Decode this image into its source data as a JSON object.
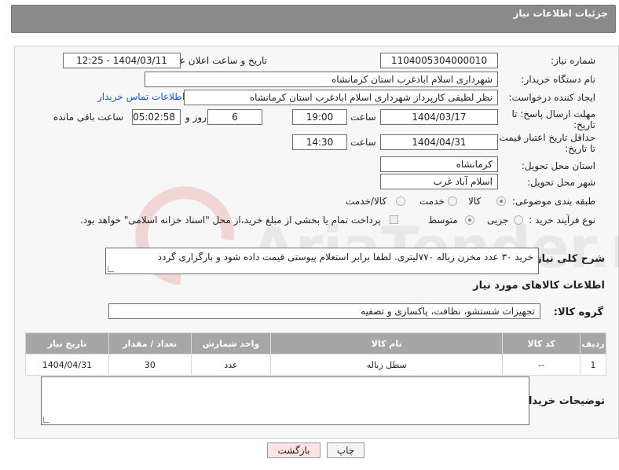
{
  "header": {
    "title": "جزئیات اطلاعات نیاز"
  },
  "form": {
    "need_number_label": "شماره نیاز:",
    "need_number": "1104005304000010",
    "announce_label": "تاریخ و ساعت اعلان عمومی:",
    "announce_value": "1404/03/11 - 12:25",
    "buyer_org_label": "نام دستگاه خریدار:",
    "buyer_org": "شهرداری اسلام ابادغرب استان کرمانشاه",
    "creator_label": "ایجاد کننده درخواست:",
    "creator": "نظر لطیفی کارپرداز شهرداری اسلام ابادغرب استان کرمانشاه",
    "contact_link": "اطلاعات تماس خریدار",
    "deadline_label_1": "مهلت ارسال پاسخ: تا",
    "deadline_label_2": "تاریخ:",
    "deadline_date": "1404/03/17",
    "time_label": "ساعت",
    "deadline_time": "19:00",
    "days_value": "6",
    "days_label": "روز و",
    "remaining_value": "05:02:58",
    "remaining_label": "ساعت باقی مانده",
    "validity_label_1": "حداقل تاریخ اعتبار قیمت:",
    "validity_label_2": "تا تاریخ:",
    "validity_date": "1404/04/31",
    "validity_time": "14:30",
    "province_label": "استان محل تحویل:",
    "province": "کرمانشاه",
    "city_label": "شهر محل تحویل:",
    "city": "اسلام آباد غرب",
    "category_label": "طبقه بندی موضوعی:",
    "category_options": [
      "کالا",
      "خدمت",
      "کالا/خدمت"
    ],
    "process_label": "نوع فرآیند خرید :",
    "process_options": [
      "جزیی",
      "متوسط"
    ],
    "payment_note": "پرداخت تمام یا بخشی از مبلغ خرید،از محل \"اسناد خزانه اسلامی\" خواهد بود.",
    "description_label": "شرح کلی نیاز:",
    "description": "خرید ۳۰ عدد مخزن زباله ۷۷۰لیتری. لطفا برابر استعلام پیوستی قیمت داده شود و بارگزاری گردد",
    "goods_info_title": "اطلاعات کالاهای مورد نیاز",
    "goods_group_label": "گروه کالا:",
    "goods_group": "تجهیزات شستشو، نظافت، پاکسازی و تصفیه",
    "buyer_notes_label": "توضیحات خریدار:"
  },
  "table": {
    "headers": [
      "ردیف",
      "کد کالا",
      "نام کالا",
      "واحد شمارش",
      "تعداد / مقدار",
      "تاریخ نیاز"
    ],
    "rows": [
      [
        "1",
        "--",
        "سطل زباله",
        "عدد",
        "30",
        "1404/04/31"
      ]
    ]
  },
  "buttons": {
    "print": "چاپ",
    "back": "بازگشت"
  },
  "watermark": "AriaTender.net",
  "colors": {
    "header_bg": "#8a8a8a",
    "table_header_bg": "#a6a6a6",
    "link": "#1a56c8",
    "back_button_bg": "#fde4e4"
  }
}
